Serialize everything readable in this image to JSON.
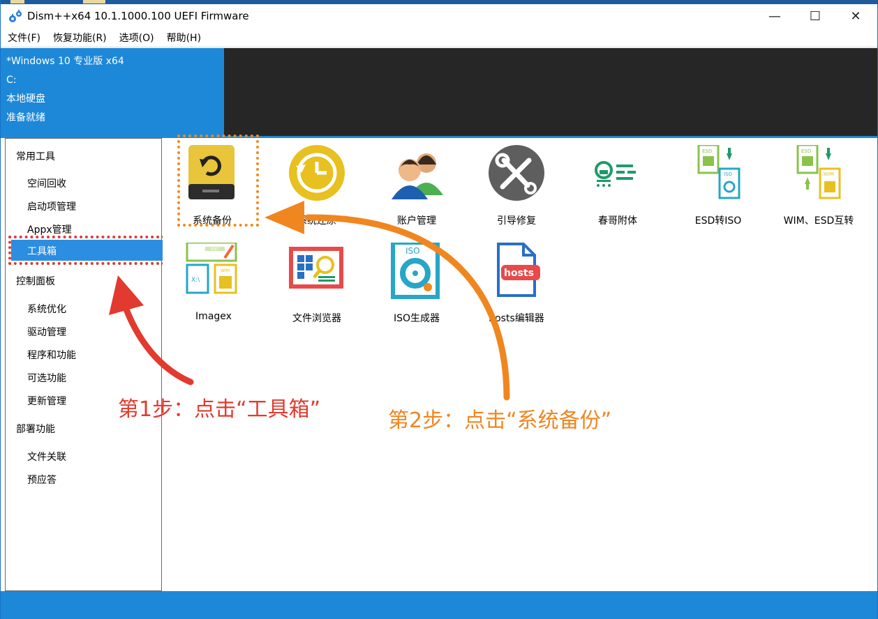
{
  "window": {
    "title": "Dism++x64 10.1.1000.100 UEFI Firmware",
    "minimize_glyph": "—",
    "maximize_glyph": "☐",
    "close_glyph": "✕"
  },
  "menu": [
    "文件(F)",
    "恢复功能(R)",
    "选项(O)",
    "帮助(H)"
  ],
  "info": {
    "os": "*Windows 10 专业版 x64",
    "drive": "C:",
    "disk": "本地硬盘",
    "status": "准备就绪"
  },
  "sidebar": {
    "group_common": "常用工具",
    "common_items": [
      "空间回收",
      "启动项管理",
      "Appx管理",
      "工具箱"
    ],
    "group_control": "控制面板",
    "control_items": [
      "系统优化",
      "驱动管理",
      "程序和功能",
      "可选功能",
      "更新管理"
    ],
    "group_deploy": "部署功能",
    "deploy_items": [
      "文件关联",
      "预应答"
    ],
    "selected": "工具箱"
  },
  "tools": [
    {
      "label": "系统备份",
      "icon": "backup-drive-icon"
    },
    {
      "label": "系统还原",
      "icon": "restore-clock-icon"
    },
    {
      "label": "账户管理",
      "icon": "users-icon"
    },
    {
      "label": "引导修复",
      "icon": "wrench-screwdriver-icon"
    },
    {
      "label": "春哥附体",
      "icon": "toggle-settings-icon"
    },
    {
      "label": "ESD转ISO",
      "icon": "esd-to-iso-icon"
    },
    {
      "label": "WIM、ESD互转",
      "icon": "wim-esd-convert-icon"
    },
    {
      "label": "Imagex",
      "icon": "imagex-icon"
    },
    {
      "label": "文件浏览器",
      "icon": "file-browser-icon"
    },
    {
      "label": "ISO生成器",
      "icon": "iso-maker-icon"
    },
    {
      "label": "hosts编辑器",
      "icon": "hosts-editor-icon"
    }
  ],
  "icon_text": {
    "esd": "ESD",
    "iso": "ISO",
    "wim": "WIM",
    "edit": "EDIT",
    "xdrive": "X:\\",
    "hosts": "hosts"
  },
  "annotations": {
    "step1": "第1步：点击“工具箱”",
    "step2": "第2步：点击“系统备份”"
  },
  "colors": {
    "accent_blue": "#1e88d8",
    "dark_panel": "#262626",
    "step1_red": "#e23a2e",
    "step2_orange": "#f0861f"
  }
}
